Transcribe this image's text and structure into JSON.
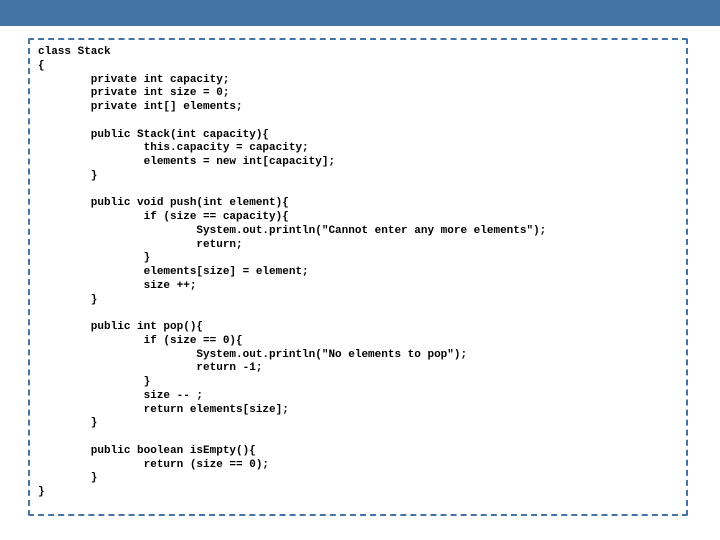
{
  "code": {
    "text": "class Stack\n{\n        private int capacity;\n        private int size = 0;\n        private int[] elements;\n\n        public Stack(int capacity){\n                this.capacity = capacity;\n                elements = new int[capacity];\n        }\n\n        public void push(int element){\n                if (size == capacity){\n                        System.out.println(\"Cannot enter any more elements\");\n                        return;\n                }\n                elements[size] = element;\n                size ++;\n        }\n\n        public int pop(){\n                if (size == 0){\n                        System.out.println(\"No elements to pop\");\n                        return -1;\n                }\n                size -- ;\n                return elements[size];\n        }\n\n        public boolean isEmpty(){\n                return (size == 0);\n        }\n}"
  }
}
